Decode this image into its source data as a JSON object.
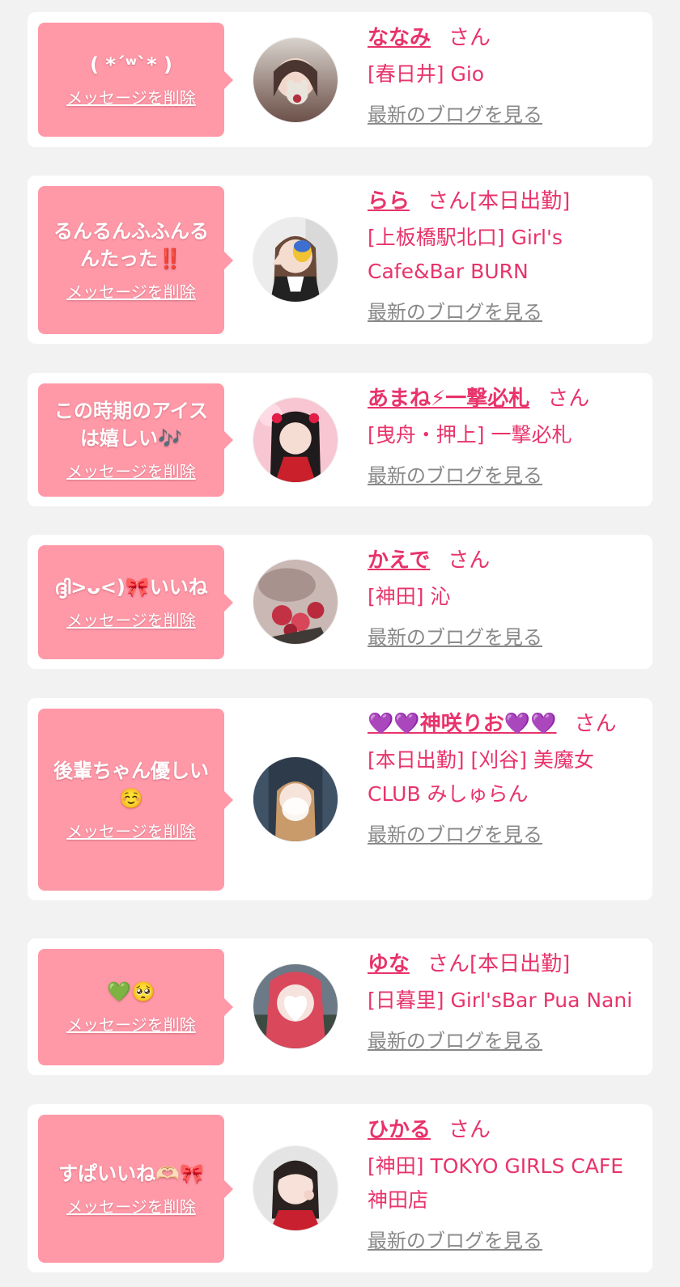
{
  "delete_label": "メッセージを削除",
  "blog_label": "最新のブログを見る",
  "entries": [
    {
      "message": "( *´ʷ`* )",
      "name": "ななみ",
      "san": "さん",
      "shop": "[春日井] Gio"
    },
    {
      "message": "るんるんふふんるんたった‼️",
      "name": "らら",
      "san": "さん[本日出勤]",
      "shop": "[上板橋駅北口] Girl's Cafe&Bar BURN"
    },
    {
      "message": "この時期のアイスは嬉しい🎶",
      "name": "あまね⚡一撃必札",
      "san": "さん",
      "shop": "[曳舟・押上] 一撃必札"
    },
    {
      "message": "ദ്ദി>ᴗ<)🎀いいね",
      "name": "かえで",
      "san": "さん",
      "shop": "[神田] 沁"
    },
    {
      "message": "後輩ちゃん優しい☺️",
      "name": "💜💜神咲りお💜💜",
      "san": "さん",
      "shop": "[本日出勤] [刈谷] 美魔女CLUB みしゅらん"
    },
    {
      "message": "💚🥺",
      "name": "ゆな",
      "san": "さん[本日出勤]",
      "shop": "[日暮里] Girl'sBar Pua Nani"
    },
    {
      "message": "すぱいいね🫶🏻🎀",
      "name": "ひかる",
      "san": "さん",
      "shop": "[神田] TOKYO GIRLS CAFE 神田店"
    }
  ]
}
